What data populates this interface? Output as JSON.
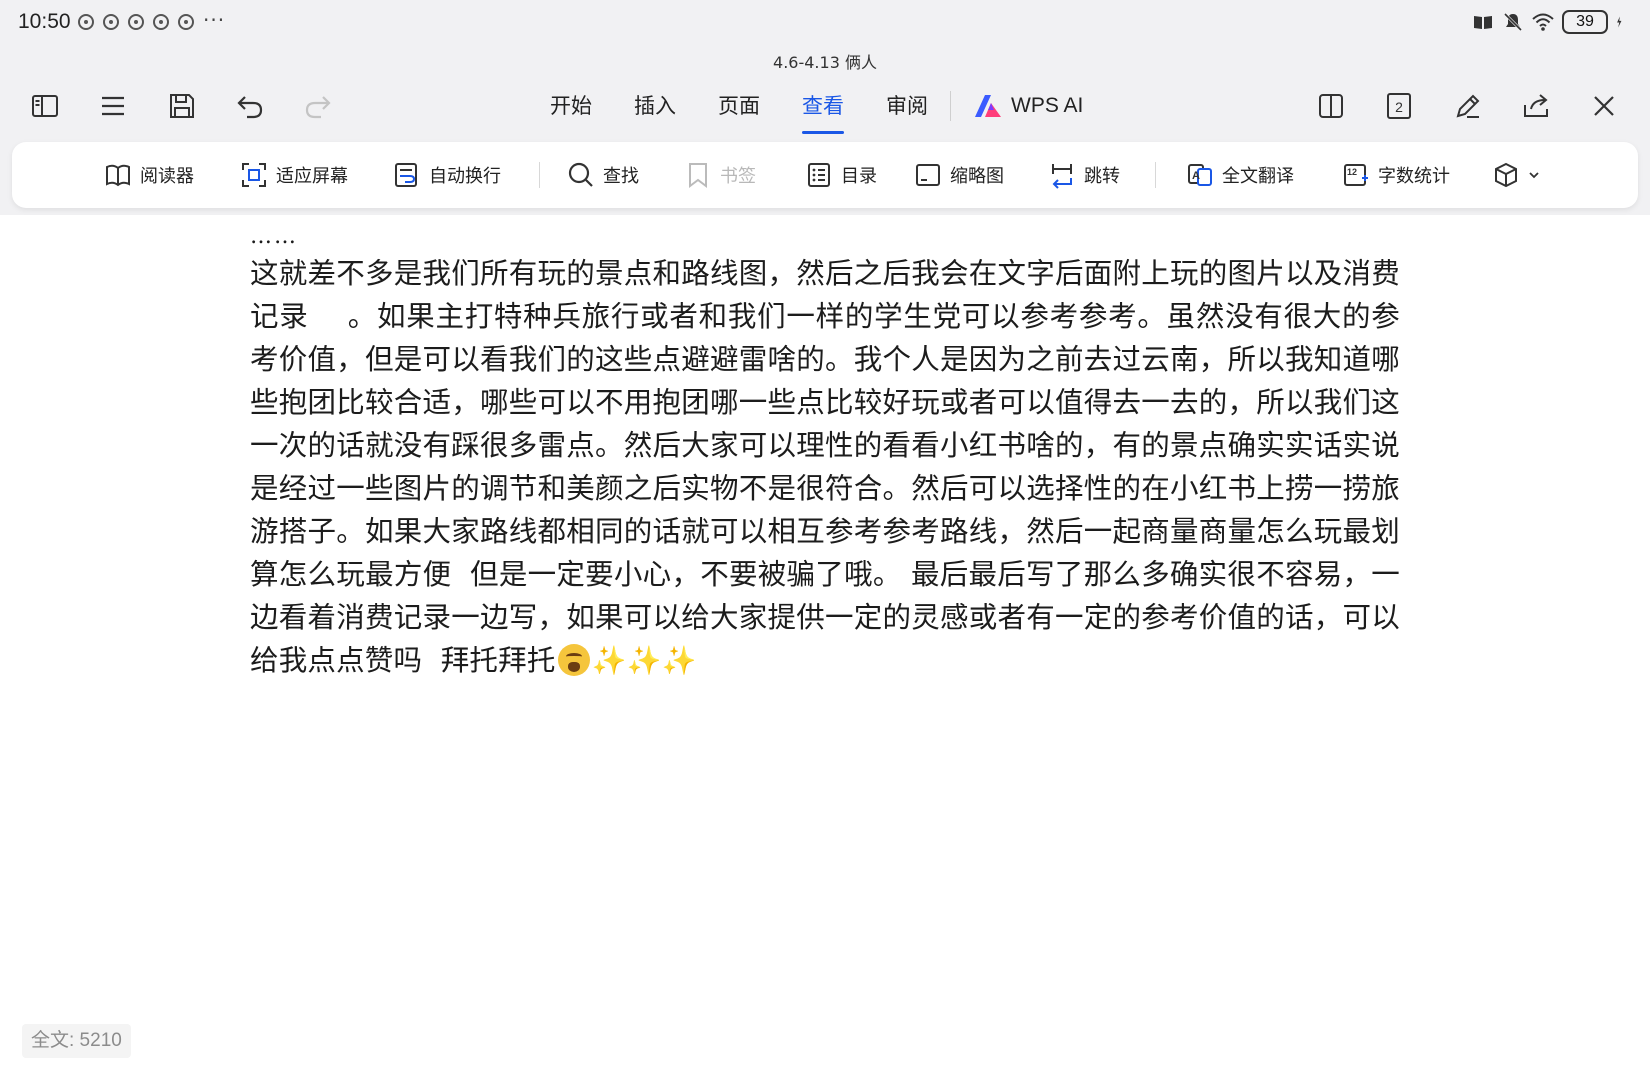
{
  "status": {
    "time": "10:50",
    "more": "···",
    "battery": "39",
    "app_icons": [
      "notification-icon-1",
      "notification-icon-2",
      "notification-icon-3",
      "notification-icon-4",
      "notification-icon-5"
    ]
  },
  "document_title": "4.6-4.13  俩人",
  "toolbar": {
    "left_icons": [
      "sidebar-icon",
      "menu-icon",
      "save-icon",
      "undo-icon",
      "redo-icon"
    ],
    "tabs": [
      "开始",
      "插入",
      "页面",
      "查看",
      "审阅"
    ],
    "active_tab": "查看",
    "ai_label": "WPS AI",
    "right_icons": [
      "split-view-icon",
      "page-number-icon",
      "edit-pen-icon",
      "share-icon",
      "close-icon"
    ],
    "page_badge": "2"
  },
  "ribbon": {
    "reader": "阅读器",
    "fit_screen": "适应屏幕",
    "auto_wrap": "自动换行",
    "find": "查找",
    "bookmark": "书签",
    "toc": "目录",
    "thumbnail": "缩略图",
    "jump": "跳转",
    "translate": "全文翻译",
    "word_count": "字数统计"
  },
  "content": {
    "ellipsis": "……",
    "body": "这就差不多是我们所有玩的景点和路线图，然后之后我会在文字后面附上玩的图片以及消费记录    。如果主打特种兵旅行或者和我们一样的学生党可以参考参考。虽然没有很大的参考价值，但是可以看我们的这些点避避雷啥的。我个人是因为之前去过云南，所以我知道哪些抱团比较合适，哪些可以不用抱团哪一些点比较好玩或者可以值得去一去的，所以我们这一次的话就没有踩很多雷点。然后大家可以理性的看看小红书啥的，有的景点确实实话实说是经过一些图片的调节和美颜之后实物不是很符合。然后可以选择性的在小红书上捞一捞旅游搭子。如果大家路线都相同的话就可以相互参考参考路线，然后一起商量商量怎么玩最划算怎么玩最方便  但是一定要小心，不要被骗了哦。 最后最后写了那么多确实很不容易，一边看着消费记录一边写，如果可以给大家提供一定的灵感或者有一定的参考价值的话，可以给我点点赞吗  拜托拜托",
    "sparkles": "✨✨✨"
  },
  "footer": {
    "word_count": "全文: 5210"
  },
  "colors": {
    "accent": "#1a57e6",
    "chrome_bg": "#f1f1f3"
  }
}
